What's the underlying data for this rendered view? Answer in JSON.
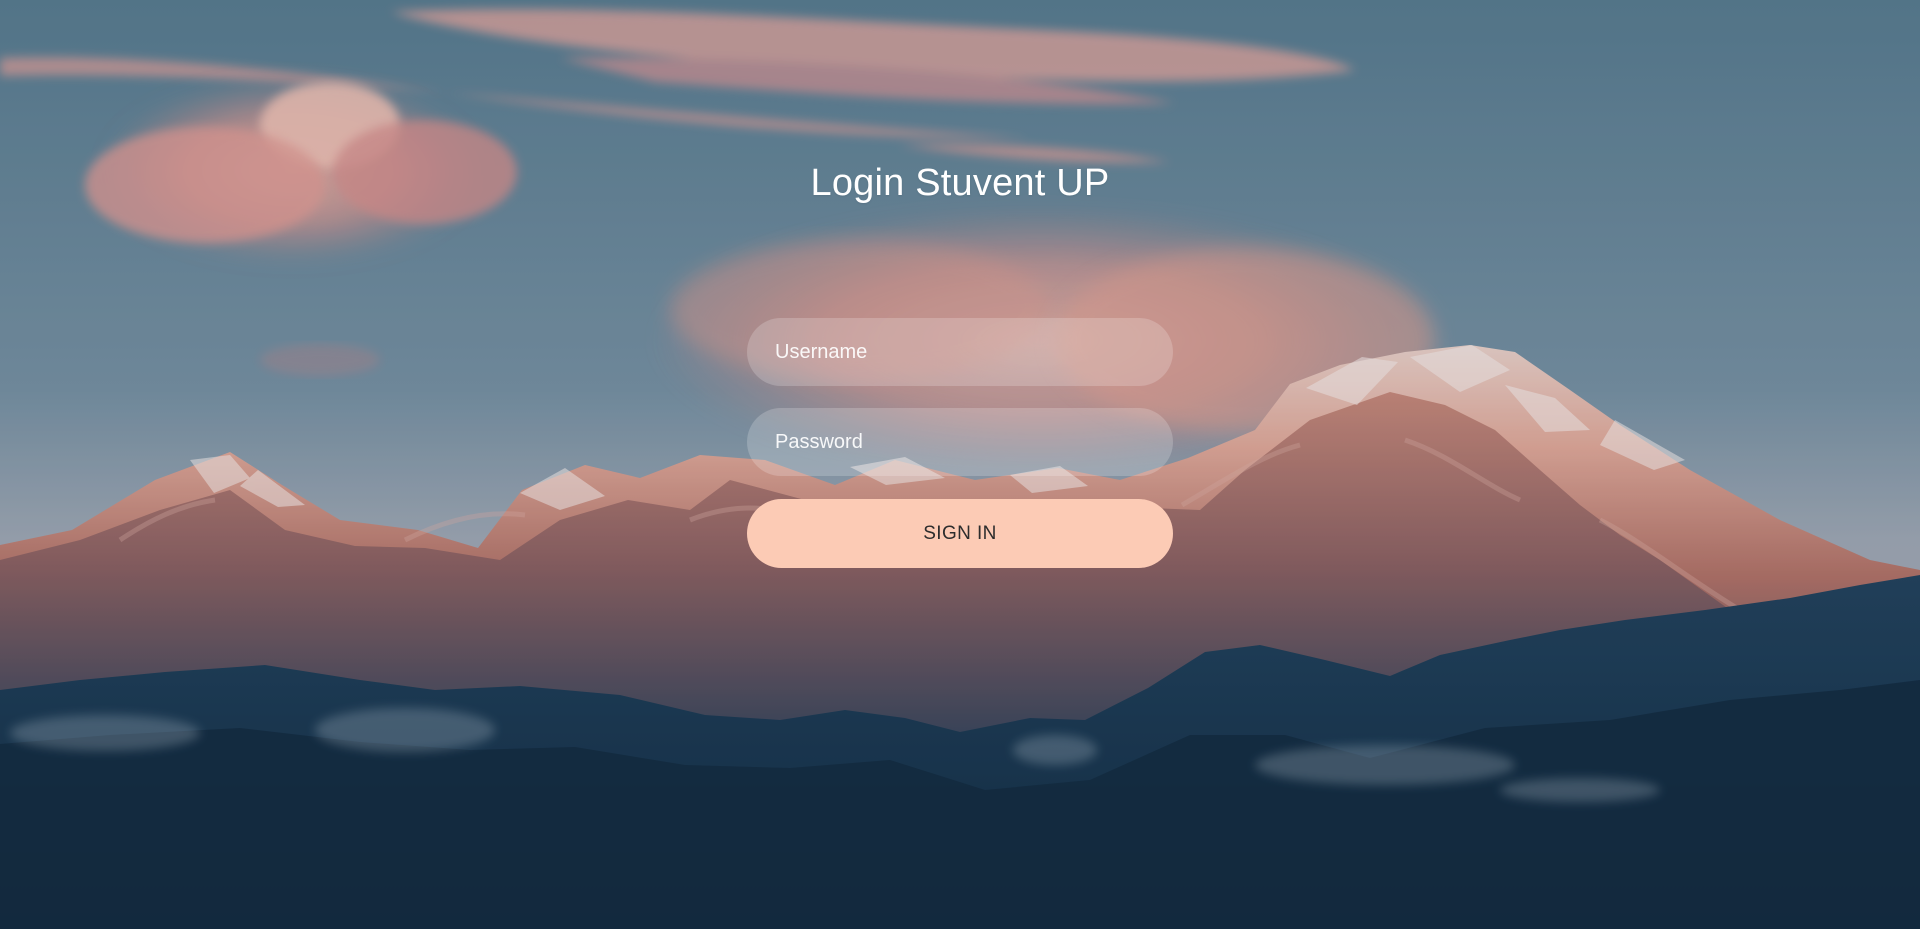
{
  "login": {
    "title": "Login Stuvent UP",
    "username_placeholder": "Username",
    "password_placeholder": "Password",
    "signin_label": "SIGN IN"
  },
  "colors": {
    "sky_top": "#587a8d",
    "sky_middle": "#8b9faf",
    "cloud_pink": "#e9a39a",
    "snow_highlight": "#f2d7cf",
    "alpenglow": "#df8d72",
    "mountain_shadow": "#17334d",
    "input_background": "rgba(255,255,255,0.2)",
    "button_background": "#fccbb5",
    "button_text": "#2d2d2d",
    "title_text": "#ffffff"
  }
}
